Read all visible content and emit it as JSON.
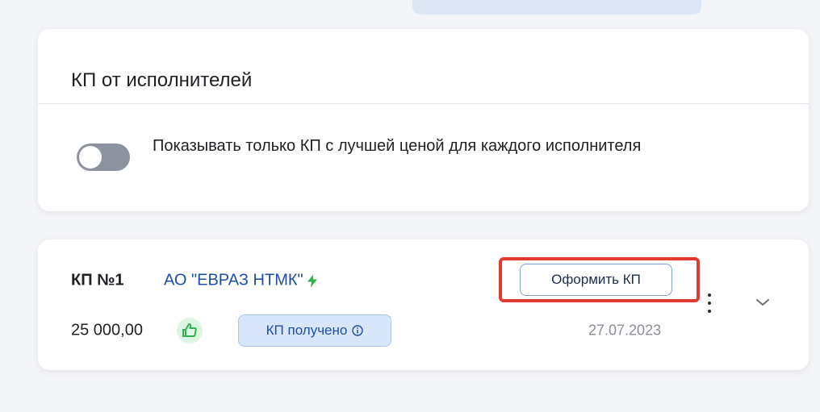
{
  "filter_card": {
    "title": "КП от исполнителей",
    "toggle_label": "Показывать только КП с лучшей ценой для каждого исполнителя",
    "toggle_on": false
  },
  "offer": {
    "number": "КП №1",
    "supplier": "АО \"ЕВРАЗ НТМК\"",
    "amount": "25 000,00",
    "status": "КП получено",
    "date": "27.07.2023",
    "create_button_label": "Оформить КП",
    "icons": {
      "supplier_badge": "bolt-icon",
      "amount_badge": "thumbs-up-icon",
      "status_hint": "info-icon",
      "more": "more-vertical-icon",
      "expand": "chevron-down-icon"
    }
  },
  "colors": {
    "background": "#f3f4f7",
    "link": "#1d4fa8",
    "status_bg": "#d8e6fb",
    "bolt": "#2fb24c",
    "highlight": "#e23b2e"
  }
}
